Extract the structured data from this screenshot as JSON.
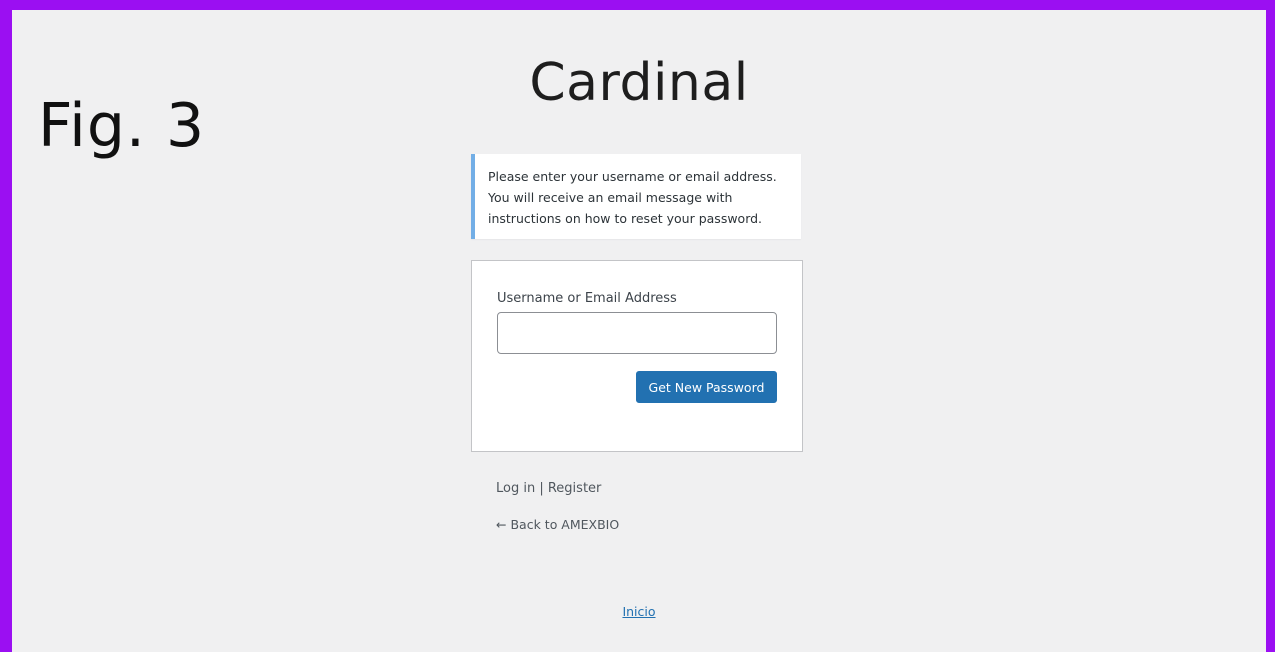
{
  "figure_label": "Fig. 3",
  "site_logo": "Cardinal",
  "notice": {
    "line1": "Please enter your username or email address.",
    "line2": "You will receive an email message with",
    "line3": "instructions on how to reset your password."
  },
  "form": {
    "field_label": "Username or Email Address",
    "field_value": "",
    "submit_label": "Get New Password"
  },
  "nav": {
    "login_label": "Log in",
    "separator": " | ",
    "register_label": "Register"
  },
  "back_link": {
    "arrow": "←",
    "label": "Back to AMEXBIO"
  },
  "footer": {
    "link_label": "Inicio"
  },
  "colors": {
    "frame_border": "#9b0ff2",
    "page_background": "#f0f0f1",
    "primary_button": "#2271b1",
    "notice_accent": "#72aee6"
  }
}
